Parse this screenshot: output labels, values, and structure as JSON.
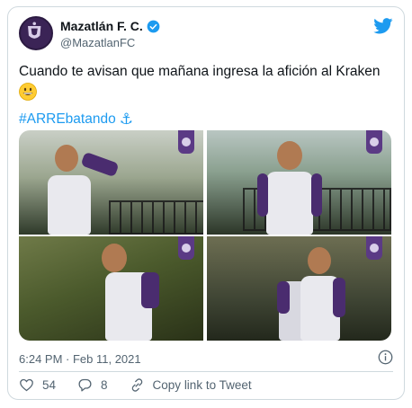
{
  "account": {
    "display_name": "Mazatlán F. C.",
    "handle": "@MazatlanFC",
    "verified": true,
    "avatar_icon": "club-crest-icon",
    "brand_color": "#3b2456"
  },
  "tweet": {
    "text": "Cuando te avisan que mañana ingresa la afición al Kraken",
    "emoji": "grinning-face-emoji",
    "hashtag": "#ARREbatando",
    "hashtag_emoji": "⚓",
    "link_color": "#1d9bf0",
    "timestamp": "6:24 PM · Feb 11, 2021"
  },
  "media": {
    "count": 4,
    "photos": [
      "player-photo-1",
      "player-photo-2",
      "player-photo-3",
      "player-photo-4"
    ]
  },
  "actions": {
    "likes_count": "54",
    "replies_count": "8",
    "copy_link_label": "Copy link to Tweet"
  }
}
